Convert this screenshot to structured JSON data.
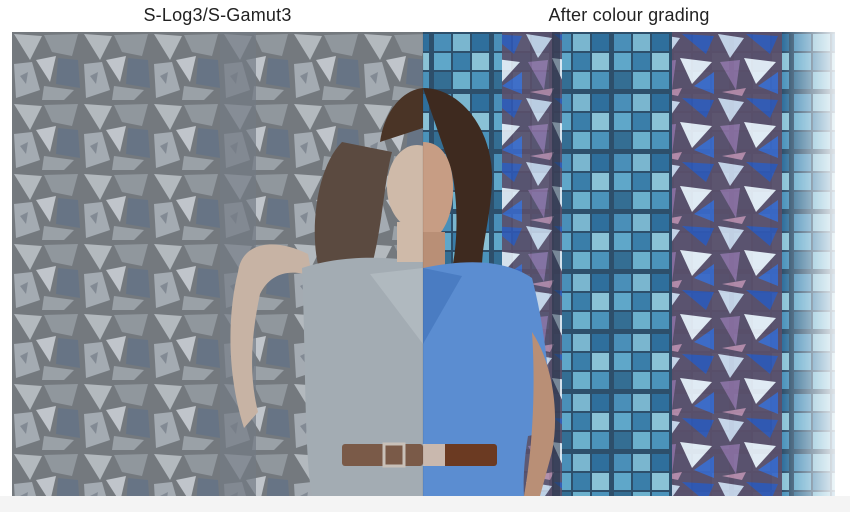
{
  "labels": {
    "left": "S-Log3/S-Gamut3",
    "right": "After colour grading"
  },
  "colors": {
    "log_wall": "#8a9097",
    "log_dress": "#a3acb3",
    "graded_wall": "#3f7fa8",
    "graded_dress": "#5b8dd1",
    "hair": "#4a3426",
    "skin": "#c9a58b",
    "belt": "#6b3a22"
  }
}
